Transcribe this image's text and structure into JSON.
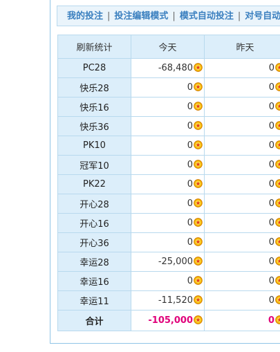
{
  "tabs": [
    "我的投注",
    "投注编辑模式",
    "模式自动投注",
    "对号自动投"
  ],
  "tab_separator": "|",
  "columns": [
    "刷新统计",
    "今天",
    "昨天"
  ],
  "rows": [
    {
      "label": "PC28",
      "today": "-68,480",
      "yesterday": "0"
    },
    {
      "label": "快乐28",
      "today": "0",
      "yesterday": "0"
    },
    {
      "label": "快乐16",
      "today": "0",
      "yesterday": "0"
    },
    {
      "label": "快乐36",
      "today": "0",
      "yesterday": "0"
    },
    {
      "label": "PK10",
      "today": "0",
      "yesterday": "0"
    },
    {
      "label": "冠军10",
      "today": "0",
      "yesterday": "0"
    },
    {
      "label": "PK22",
      "today": "0",
      "yesterday": "0"
    },
    {
      "label": "开心28",
      "today": "0",
      "yesterday": "0"
    },
    {
      "label": "开心16",
      "today": "0",
      "yesterday": "0"
    },
    {
      "label": "开心36",
      "today": "0",
      "yesterday": "0"
    },
    {
      "label": "幸运28",
      "today": "-25,000",
      "yesterday": "0"
    },
    {
      "label": "幸运16",
      "today": "0",
      "yesterday": "0"
    },
    {
      "label": "幸运11",
      "today": "-11,520",
      "yesterday": "0"
    }
  ],
  "total": {
    "label": "合计",
    "today": "-105,000",
    "yesterday": "0"
  },
  "colors": {
    "accent": "#3a7fbf",
    "header_bg": "#dceefa",
    "border": "#b8d9ee",
    "negative_total": "#e0007a",
    "coin": "#f5b800"
  },
  "icon": "coin-icon"
}
